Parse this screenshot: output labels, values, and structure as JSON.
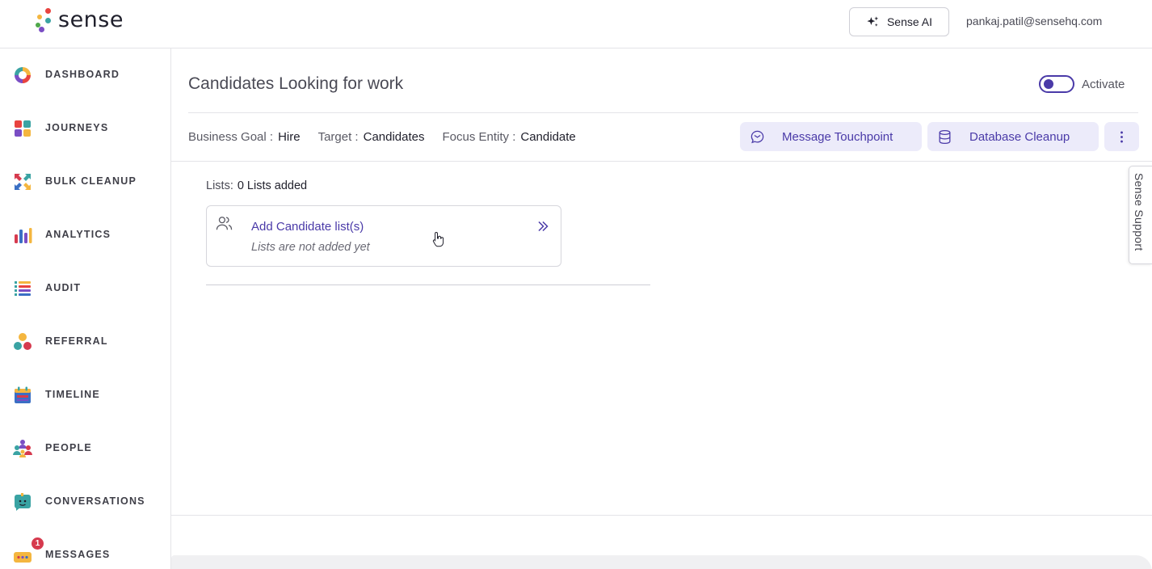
{
  "app": {
    "brand": "sense"
  },
  "header": {
    "ai_button_label": "Sense AI",
    "user_email": "pankaj.patil@sensehq.com"
  },
  "sidebar": {
    "items": [
      {
        "label": "DASHBOARD",
        "icon": "dashboard-icon"
      },
      {
        "label": "JOURNEYS",
        "icon": "journeys-icon"
      },
      {
        "label": "BULK CLEANUP",
        "icon": "bulk-cleanup-icon"
      },
      {
        "label": "ANALYTICS",
        "icon": "analytics-icon"
      },
      {
        "label": "AUDIT",
        "icon": "audit-icon"
      },
      {
        "label": "REFERRAL",
        "icon": "referral-icon"
      },
      {
        "label": "TIMELINE",
        "icon": "timeline-icon"
      },
      {
        "label": "PEOPLE",
        "icon": "people-icon"
      },
      {
        "label": "CONVERSATIONS",
        "icon": "conversations-icon"
      },
      {
        "label": "MESSAGES",
        "icon": "messages-icon",
        "badge": "1"
      }
    ]
  },
  "page": {
    "title": "Candidates Looking for work",
    "activate_label": "Activate",
    "activated": true,
    "meta": {
      "business_goal_label": "Business Goal :",
      "business_goal_value": "Hire",
      "target_label": "Target :",
      "target_value": "Candidates",
      "focus_entity_label": "Focus Entity :",
      "focus_entity_value": "Candidate"
    },
    "actions": {
      "message_touchpoint": "Message Touchpoint",
      "database_cleanup": "Database Cleanup"
    },
    "lists": {
      "label": "Lists:",
      "count_text": "0 Lists added",
      "card_title": "Add Candidate list(s)",
      "card_subtitle": "Lists are not added yet"
    }
  },
  "support_tab": "Sense Support",
  "colors": {
    "accent": "#4a3aa8",
    "accent_bg": "#ecebfa",
    "badge": "#d63a4e"
  }
}
